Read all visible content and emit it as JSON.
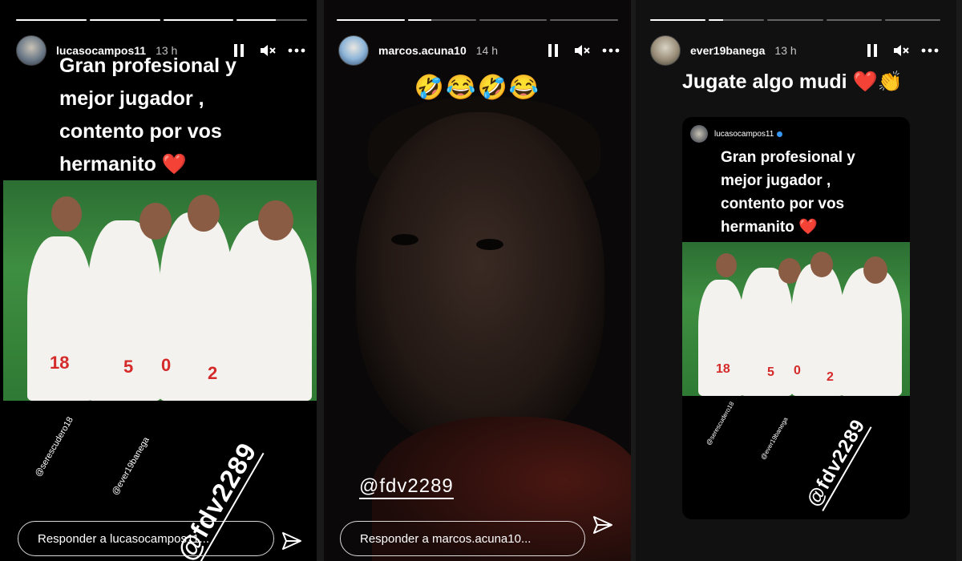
{
  "stories": [
    {
      "username": "lucasocampos11",
      "time": "13 h",
      "progress": [
        1,
        1,
        1,
        0.55
      ],
      "caption_lines": [
        "Gran profesional y",
        "mejor jugador ,",
        "contento por vos",
        "hermanito"
      ],
      "caption_emoji": "❤️",
      "mentions": [
        "@serescudero18",
        "@ever19banega",
        "@fdv2289"
      ],
      "jersey_numbers": [
        "18",
        "5",
        "0",
        "2"
      ],
      "reply_placeholder": "Responder a lucasocampos11..."
    },
    {
      "username": "marcos.acuna10",
      "time": "14 h",
      "progress": [
        1,
        0.35,
        0,
        0
      ],
      "emojis": "🤣😂🤣😂",
      "mention": "@fdv2289",
      "reply_placeholder": "Responder a marcos.acuna10..."
    },
    {
      "username": "ever19banega",
      "time": "13 h",
      "progress": [
        1,
        0.25,
        0,
        0,
        0
      ],
      "caption": "Jugate algo mudi",
      "caption_emoji": "❤️👏",
      "shared_post": {
        "username": "lucasocampos11",
        "caption_lines": [
          "Gran profesional y",
          "mejor jugador ,",
          "contento por vos",
          "hermanito"
        ],
        "caption_emoji": "❤️",
        "mentions": [
          "@serescudero18",
          "@ever19banega",
          "@fdv2289"
        ],
        "jersey_numbers": [
          "18",
          "5",
          "0",
          "2"
        ]
      }
    }
  ],
  "icons": {
    "pause": "pause-icon",
    "mute": "muted-speaker-icon",
    "more": "more-horizontal-icon",
    "send": "paper-plane-icon"
  },
  "colors": {
    "heart": "#ff2d4b",
    "jersey_number": "#d42a2a",
    "verified": "#3897f0"
  }
}
